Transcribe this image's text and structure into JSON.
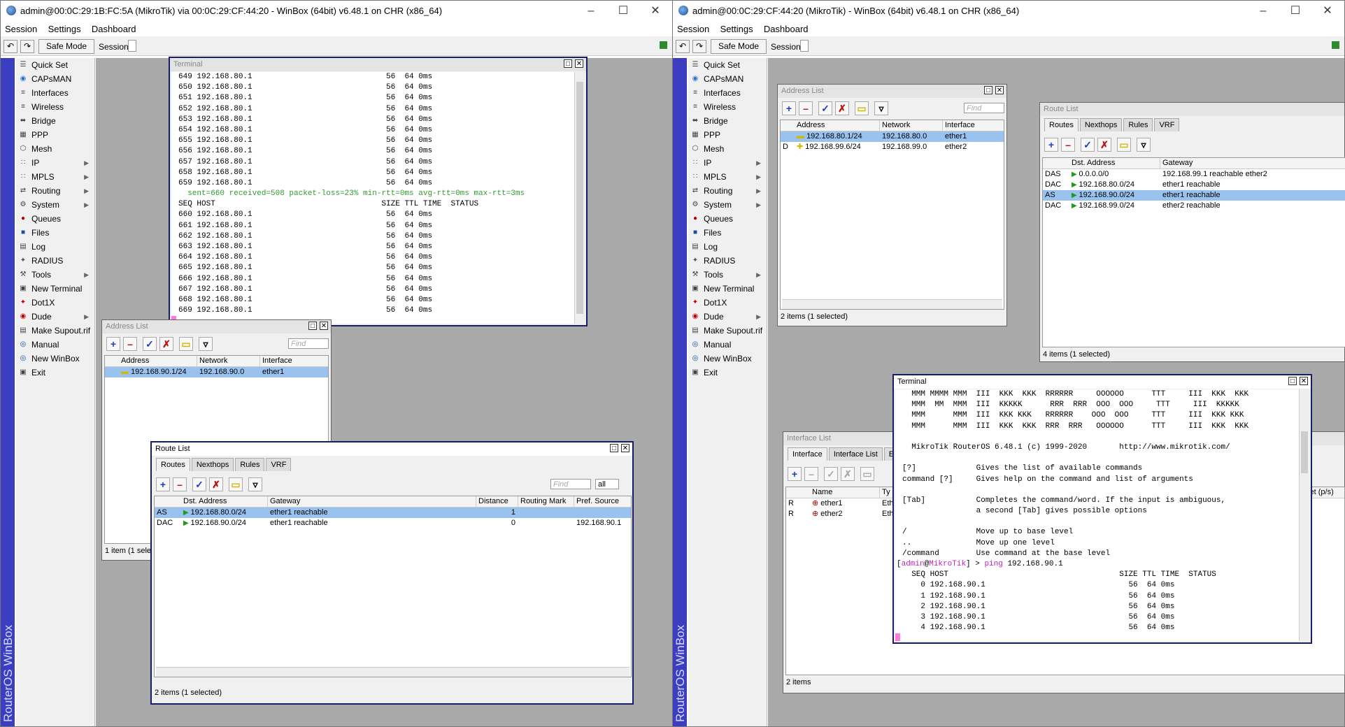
{
  "left_window": {
    "title": "admin@00:0C:29:1B:FC:5A (MikroTik) via 00:0C:29:CF:44:20 - WinBox (64bit) v6.48.1 on CHR (x86_64)",
    "menu": [
      "Session",
      "Settings",
      "Dashboard"
    ],
    "safe_mode": "Safe Mode",
    "session_label": "Session:",
    "brand": "RouterOS WinBox",
    "terminal": {
      "title": "Terminal",
      "lines_top": [
        "649 192.168.80.1                             56  64 0ms",
        "650 192.168.80.1                             56  64 0ms",
        "651 192.168.80.1                             56  64 0ms",
        "652 192.168.80.1                             56  64 0ms",
        "653 192.168.80.1                             56  64 0ms",
        "654 192.168.80.1                             56  64 0ms",
        "655 192.168.80.1                             56  64 0ms",
        "656 192.168.80.1                             56  64 0ms",
        "657 192.168.80.1                             56  64 0ms",
        "658 192.168.80.1                             56  64 0ms",
        "659 192.168.80.1                             56  64 0ms"
      ],
      "summary": "  sent=660 received=508 packet-loss=23% min-rtt=0ms avg-rtt=0ms max-rtt=3ms",
      "header": "SEQ HOST                                    SIZE TTL TIME  STATUS",
      "lines_bottom": [
        "660 192.168.80.1                             56  64 0ms",
        "661 192.168.80.1                             56  64 0ms",
        "662 192.168.80.1                             56  64 0ms",
        "663 192.168.80.1                             56  64 0ms",
        "664 192.168.80.1                             56  64 0ms",
        "665 192.168.80.1                             56  64 0ms",
        "666 192.168.80.1                             56  64 0ms",
        "667 192.168.80.1                             56  64 0ms",
        "668 192.168.80.1                             56  64 0ms",
        "669 192.168.80.1                             56  64 0ms"
      ]
    },
    "address_list": {
      "title": "Address List",
      "find": "Find",
      "columns": [
        "Address",
        "Network",
        "Interface"
      ],
      "rows": [
        {
          "flag": "",
          "address": "192.168.90.1/24",
          "network": "192.168.90.0",
          "interface": "ether1"
        }
      ],
      "status": "1 item (1 selec"
    },
    "route_list": {
      "title": "Route List",
      "tabs": [
        "Routes",
        "Nexthops",
        "Rules",
        "VRF"
      ],
      "find": "Find",
      "filter": "all",
      "columns": [
        "Dst. Address",
        "Gateway",
        "Distance",
        "Routing Mark",
        "Pref. Source"
      ],
      "rows": [
        {
          "flag": "AS",
          "dst": "192.168.80.0/24",
          "gateway": "ether1 reachable",
          "distance": "1",
          "mark": "",
          "pref": ""
        },
        {
          "flag": "DAC",
          "dst": "192.168.90.0/24",
          "gateway": "ether1 reachable",
          "distance": "0",
          "mark": "",
          "pref": "192.168.90.1"
        }
      ],
      "status": "2 items (1 selected)"
    }
  },
  "right_window": {
    "title": "admin@00:0C:29:CF:44:20 (MikroTik) - WinBox (64bit) v6.48.1 on CHR (x86_64)",
    "menu": [
      "Session",
      "Settings",
      "Dashboard"
    ],
    "safe_mode": "Safe Mode",
    "session_label": "Session:",
    "brand": "RouterOS WinBox",
    "address_list": {
      "title": "Address List",
      "find": "Find",
      "columns": [
        "Address",
        "Network",
        "Interface"
      ],
      "rows": [
        {
          "flag": "",
          "address": "192.168.80.1/24",
          "network": "192.168.80.0",
          "interface": "ether1"
        },
        {
          "flag": "D",
          "address": "192.168.99.6/24",
          "network": "192.168.99.0",
          "interface": "ether2"
        }
      ],
      "status": "2 items (1 selected)"
    },
    "route_list": {
      "title": "Route List",
      "tabs": [
        "Routes",
        "Nexthops",
        "Rules",
        "VRF"
      ],
      "columns": [
        "Dst. Address",
        "Gateway"
      ],
      "rows": [
        {
          "flag": "DAS",
          "dst": "0.0.0.0/0",
          "gateway": "192.168.99.1 reachable ether2"
        },
        {
          "flag": "DAC",
          "dst": "192.168.80.0/24",
          "gateway": "ether1 reachable"
        },
        {
          "flag": "AS",
          "dst": "192.168.90.0/24",
          "gateway": "ether1 reachable"
        },
        {
          "flag": "DAC",
          "dst": "192.168.99.0/24",
          "gateway": "ether2 reachable"
        }
      ],
      "status": "4 items (1 selected)"
    },
    "interface_list": {
      "title": "Interface List",
      "tabs": [
        "Interface",
        "Interface List",
        "Eth"
      ],
      "columns": [
        "Name",
        "Ty"
      ],
      "extra_col": "ket (p/s)",
      "rows": [
        {
          "flag": "R",
          "name": "ether1",
          "type": "Eth"
        },
        {
          "flag": "R",
          "name": "ether2",
          "type": "Eth"
        }
      ],
      "status": "2 items"
    },
    "terminal": {
      "title": "Terminal",
      "banner": [
        "  MMM MMMM MMM  III  KKK  KKK  RRRRRR     OOOOOO      TTT     III  KKK  KKK",
        "  MMM  MM  MMM  III  KKKKK      RRR  RRR  OOO  OOO     TTT     III  KKKKK",
        "  MMM      MMM  III  KKK KKK   RRRRRR    OOO  OOO     TTT     III  KKK KKK",
        "  MMM      MMM  III  KKK  KKK  RRR  RRR   OOOOOO      TTT     III  KKK  KKK"
      ],
      "version": "  MikroTik RouterOS 6.48.1 (c) 1999-2020       http://www.mikrotik.com/",
      "help": [
        "[?]             Gives the list of available commands",
        "command [?]     Gives help on the command and list of arguments",
        "",
        "[Tab]           Completes the command/word. If the input is ambiguous,",
        "                a second [Tab] gives possible options",
        "",
        "/               Move up to base level",
        "..              Move up one level",
        "/command        Use command at the base level"
      ],
      "prompt_user": "admin",
      "prompt_at": "@",
      "prompt_host": "MikroTik",
      "prompt_tail": "] > ",
      "prompt_cmd": "ping",
      "prompt_arg": " 192.168.90.1",
      "header": "  SEQ HOST                                     SIZE TTL TIME  STATUS",
      "lines": [
        "    0 192.168.90.1                               56  64 0ms",
        "    1 192.168.90.1                               56  64 0ms",
        "    2 192.168.90.1                               56  64 0ms",
        "    3 192.168.90.1                               56  64 0ms",
        "    4 192.168.90.1                               56  64 0ms"
      ]
    }
  },
  "sidebar": [
    {
      "label": "Quick Set",
      "icon": "quick-set-icon",
      "sub": false
    },
    {
      "label": "CAPsMAN",
      "icon": "capsman-icon",
      "sub": false
    },
    {
      "label": "Interfaces",
      "icon": "interfaces-icon",
      "sub": false
    },
    {
      "label": "Wireless",
      "icon": "wireless-icon",
      "sub": false
    },
    {
      "label": "Bridge",
      "icon": "bridge-icon",
      "sub": false
    },
    {
      "label": "PPP",
      "icon": "ppp-icon",
      "sub": false
    },
    {
      "label": "Mesh",
      "icon": "mesh-icon",
      "sub": false
    },
    {
      "label": "IP",
      "icon": "ip-icon",
      "sub": true
    },
    {
      "label": "MPLS",
      "icon": "mpls-icon",
      "sub": true
    },
    {
      "label": "Routing",
      "icon": "routing-icon",
      "sub": true
    },
    {
      "label": "System",
      "icon": "system-icon",
      "sub": true
    },
    {
      "label": "Queues",
      "icon": "queues-icon",
      "sub": false
    },
    {
      "label": "Files",
      "icon": "files-icon",
      "sub": false
    },
    {
      "label": "Log",
      "icon": "log-icon",
      "sub": false
    },
    {
      "label": "RADIUS",
      "icon": "radius-icon",
      "sub": false
    },
    {
      "label": "Tools",
      "icon": "tools-icon",
      "sub": true
    },
    {
      "label": "New Terminal",
      "icon": "terminal-icon",
      "sub": false
    },
    {
      "label": "Dot1X",
      "icon": "dot1x-icon",
      "sub": false
    },
    {
      "label": "Dude",
      "icon": "dude-icon",
      "sub": true
    },
    {
      "label": "Make Supout.rif",
      "icon": "supout-icon",
      "sub": false
    },
    {
      "label": "Manual",
      "icon": "manual-icon",
      "sub": false
    },
    {
      "label": "New WinBox",
      "icon": "winbox-icon",
      "sub": false
    },
    {
      "label": "Exit",
      "icon": "exit-icon",
      "sub": false
    }
  ],
  "colors": {
    "strip": "#3b3ec0",
    "selected_row": "#99c2ee",
    "terminal_green": "#2e9e2e",
    "prompt_magenta": "#c21ec2"
  }
}
